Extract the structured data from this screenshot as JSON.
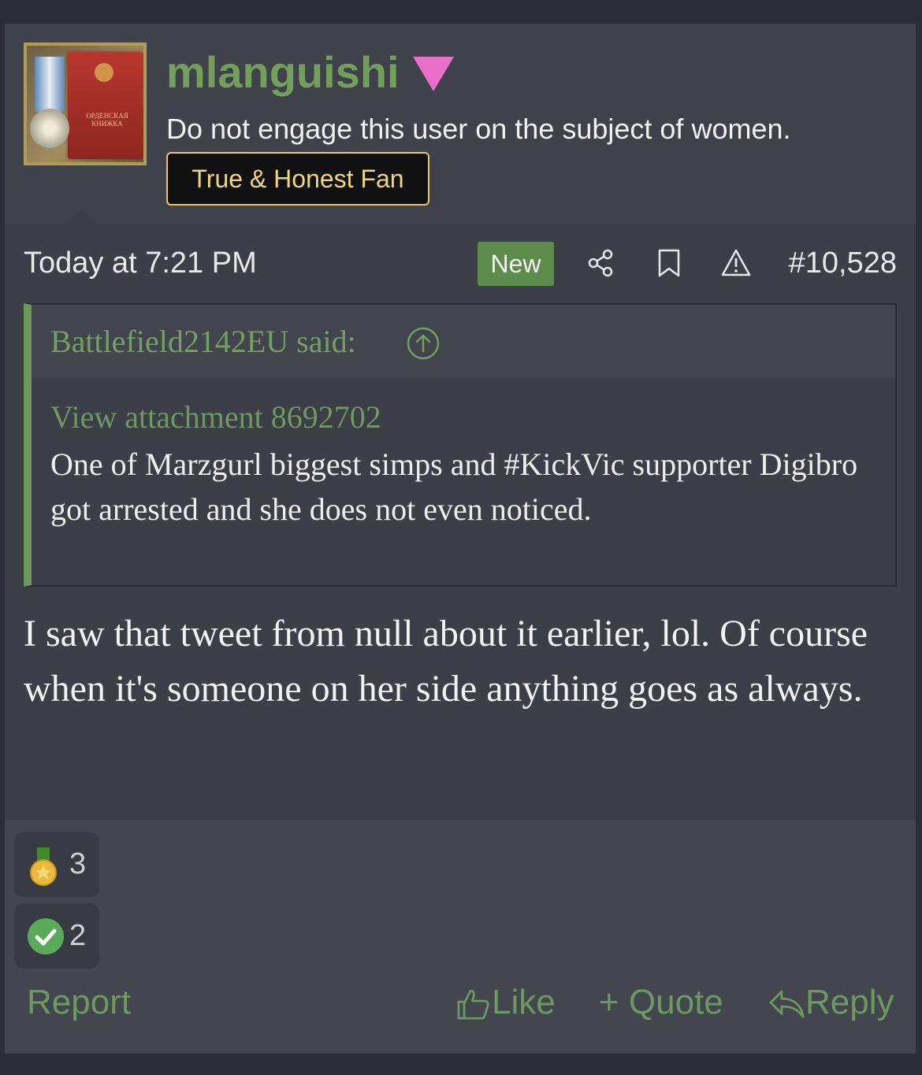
{
  "post": {
    "username": "mlanguishi",
    "user_title": "Do not engage this user on the subject of women.",
    "badge": "True & Honest Fan",
    "avatar_text": "ОРДЕНСКАЯ КНИЖКА",
    "date": "Today at 7:21 PM",
    "new_tag": "New",
    "post_number": "#10,528",
    "icons": [
      "share-icon",
      "bookmark-icon",
      "warning-icon"
    ]
  },
  "quote": {
    "author_line": "Battlefield2142EU said:",
    "attachment_link": "View attachment 8692702",
    "text": "One of Marzgurl biggest simps and #KickVic supporter Digibro got arrested and she does not even noticed."
  },
  "body": "I saw that tweet from null about it earlier, lol. Of course when it's someone on her side anything goes as always.",
  "reactions": [
    {
      "icon": "medal-icon",
      "count": "3"
    },
    {
      "icon": "check-icon",
      "count": "2"
    }
  ],
  "actions": {
    "report": "Report",
    "like": "Like",
    "quote": "+ Quote",
    "reply": "Reply"
  },
  "colors": {
    "accent_green": "#72a05a",
    "badge_gold": "#e8c860",
    "username_marker": "#e870c8",
    "background": "#3c3f48"
  }
}
